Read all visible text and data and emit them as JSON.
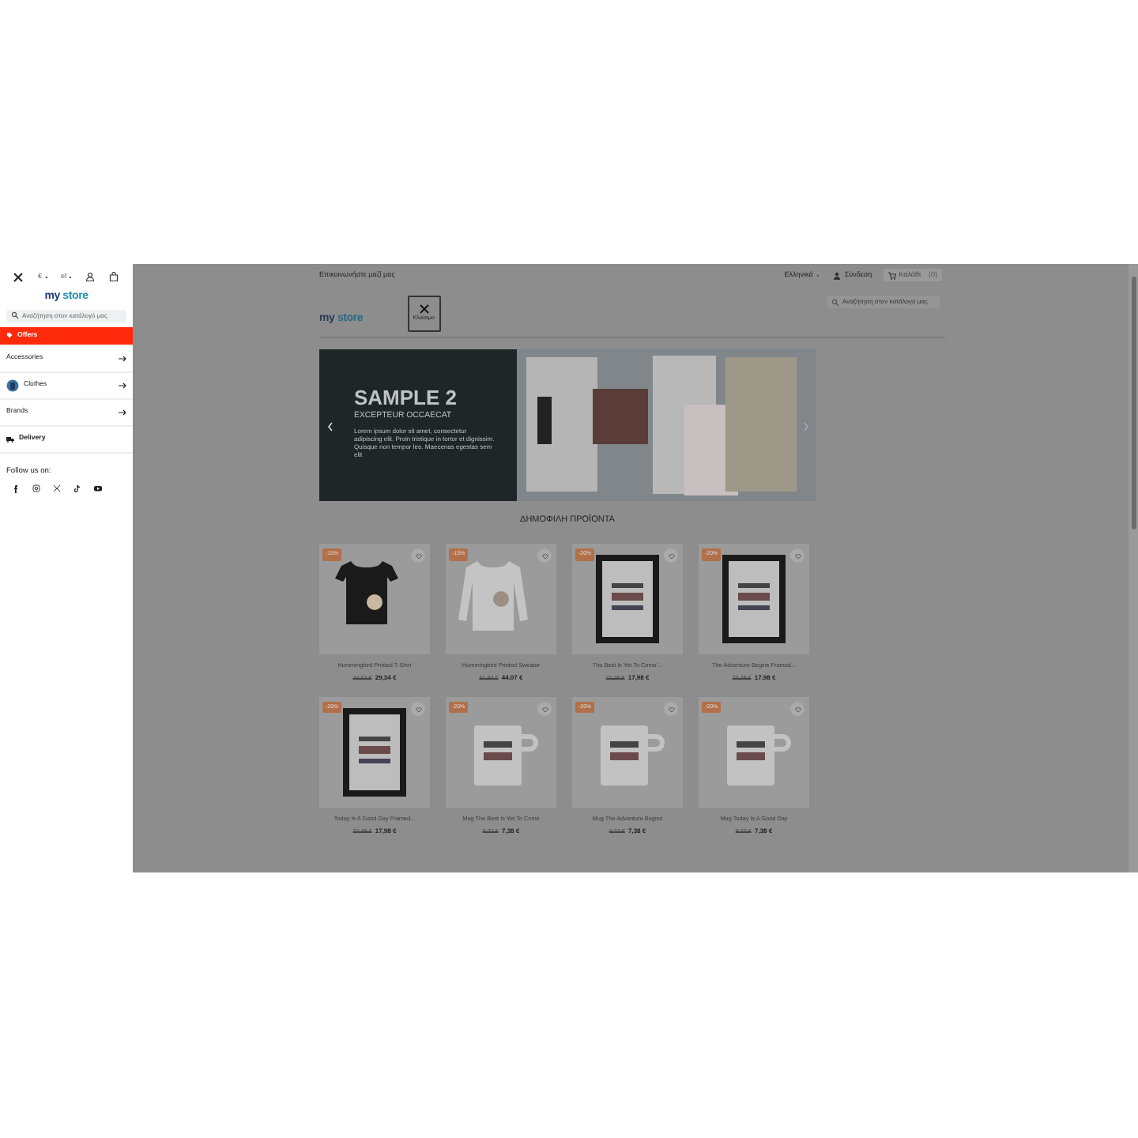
{
  "sidebar": {
    "currency": "€",
    "language": "el",
    "logo": {
      "first": "my",
      "second": "store"
    },
    "search": {
      "placeholder": "Αναζήτηση στον κατάλογό μας"
    },
    "menu": [
      {
        "label": "Offers",
        "kind": "offer",
        "highlighted": true,
        "expandable": false
      },
      {
        "label": "Accessories",
        "kind": "plain",
        "highlighted": false,
        "expandable": true
      },
      {
        "label": "Clothes",
        "kind": "image",
        "highlighted": false,
        "expandable": true
      },
      {
        "label": "Brands",
        "kind": "plain",
        "highlighted": false,
        "expandable": true
      },
      {
        "label": "Delivery",
        "kind": "delivery",
        "highlighted": false,
        "expandable": false
      }
    ],
    "follow_label": "Follow us on:"
  },
  "header": {
    "contact": "Επικοινωνήστε μαζί μας",
    "language": "Ελληνικά",
    "sign_in": "Σύνδεση",
    "cart": "Καλάθι",
    "cart_count": "(0)",
    "logo": {
      "first": "my",
      "second": "store"
    },
    "close_label": "Κλείσιμο",
    "search": {
      "placeholder": "Αναζήτηση στον κατάλογό μας"
    }
  },
  "banner": {
    "title": "SAMPLE 2",
    "subtitle": "EXCEPTEUR OCCAECAT",
    "text": "Lorem ipsum dolor sit amet, consectetur adipiscing elit. Proin tristique in tortor et dignissim. Quisque non tempor leo. Maecenas egestas sem elit"
  },
  "section_title": "ΔΗΜΟΦΙΛΗ ΠΡΟΪΟΝΤΑ",
  "products": [
    {
      "name": "Hummingbird Printed T-Shirt",
      "discount": "-15%",
      "old_price": "34,52 €",
      "price": "29,34 €",
      "kind": "tshirt"
    },
    {
      "name": "Hummingbird Printed Sweater",
      "discount": "-15%",
      "old_price": "51,84 €",
      "price": "44,07 €",
      "kind": "sweater"
    },
    {
      "name": "The Best Is Yet To Come'...",
      "discount": "-20%",
      "old_price": "22,48 €",
      "price": "17,98 €",
      "kind": "frame"
    },
    {
      "name": "The Adventure Begins Framed...",
      "discount": "-20%",
      "old_price": "22,48 €",
      "price": "17,98 €",
      "kind": "frame"
    },
    {
      "name": "Today Is A Good Day Framed...",
      "discount": "-20%",
      "old_price": "22,48 €",
      "price": "17,98 €",
      "kind": "frame"
    },
    {
      "name": "Mug The Best Is Yet To Come",
      "discount": "-20%",
      "old_price": "9,22 €",
      "price": "7,38 €",
      "kind": "mug"
    },
    {
      "name": "Mug The Adventure Begins",
      "discount": "-20%",
      "old_price": "9,22 €",
      "price": "7,38 €",
      "kind": "mug"
    },
    {
      "name": "Mug Today Is A Good Day",
      "discount": "-20%",
      "old_price": "9,22 €",
      "price": "7,38 €",
      "kind": "mug"
    }
  ]
}
